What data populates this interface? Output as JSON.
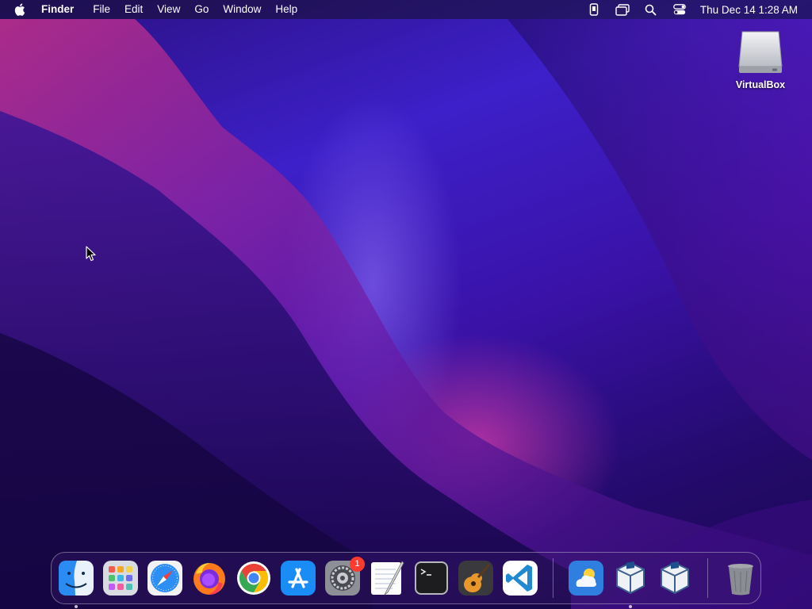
{
  "menubar": {
    "apple_icon": "apple-icon",
    "app_name": "Finder",
    "menus": [
      "File",
      "Edit",
      "View",
      "Go",
      "Window",
      "Help"
    ],
    "status_icons": [
      "phone-mirror-icon",
      "screen-mirroring-icon",
      "spotlight-search-icon",
      "control-center-icon"
    ],
    "clock": "Thu Dec 14  1:28 AM"
  },
  "desktop": {
    "icons": [
      {
        "label": "VirtualBox",
        "icon": "external-drive-icon"
      }
    ]
  },
  "dock": {
    "apps": [
      {
        "name": "Finder",
        "icon": "finder-icon",
        "running": true
      },
      {
        "name": "Launchpad",
        "icon": "launchpad-icon",
        "running": false
      },
      {
        "name": "Safari",
        "icon": "safari-icon",
        "running": false
      },
      {
        "name": "Firefox",
        "icon": "firefox-icon",
        "running": false
      },
      {
        "name": "Google Chrome",
        "icon": "chrome-icon",
        "running": false
      },
      {
        "name": "App Store",
        "icon": "app-store-icon",
        "running": false
      },
      {
        "name": "System Preferences",
        "icon": "system-preferences-icon",
        "running": false,
        "badge": "1"
      },
      {
        "name": "TextEdit",
        "icon": "textedit-icon",
        "running": false
      },
      {
        "name": "Terminal",
        "icon": "terminal-icon",
        "running": false
      },
      {
        "name": "GarageBand",
        "icon": "garageband-icon",
        "running": false
      },
      {
        "name": "Visual Studio Code",
        "icon": "vscode-icon",
        "running": false
      }
    ],
    "recent": [
      {
        "name": "Weather",
        "icon": "weather-icon",
        "running": false
      },
      {
        "name": "VirtualBox",
        "icon": "virtualbox-icon",
        "running": true
      },
      {
        "name": "VirtualBox VM",
        "icon": "virtualbox-vm-icon",
        "running": false
      }
    ],
    "trash": {
      "name": "Trash",
      "icon": "trash-icon"
    }
  }
}
